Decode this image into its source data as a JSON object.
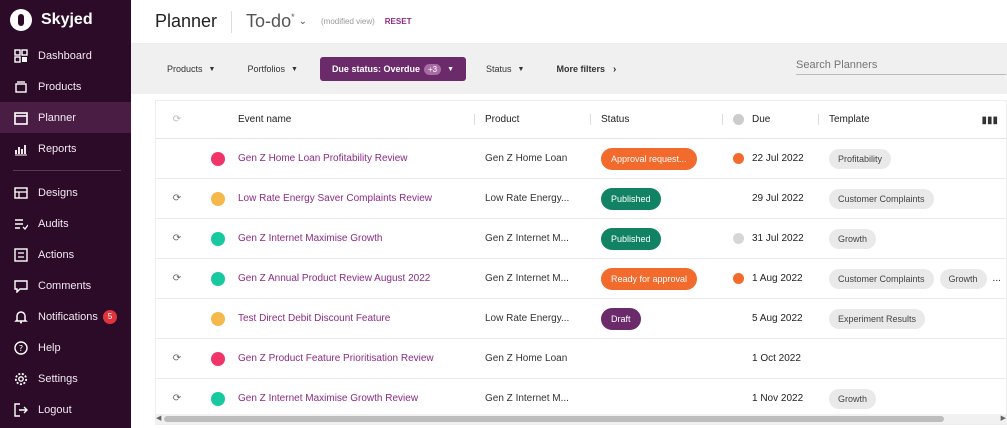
{
  "brand": {
    "name": "Skyjed"
  },
  "sidebar": {
    "items": [
      {
        "label": "Dashboard",
        "icon": "dashboard-icon"
      },
      {
        "label": "Products",
        "icon": "products-icon"
      },
      {
        "label": "Planner",
        "icon": "calendar-icon",
        "active": true
      },
      {
        "label": "Reports",
        "icon": "reports-icon"
      },
      {
        "label": "Designs",
        "icon": "designs-icon"
      },
      {
        "label": "Audits",
        "icon": "audits-icon"
      },
      {
        "label": "Actions",
        "icon": "actions-icon"
      },
      {
        "label": "Comments",
        "icon": "comments-icon"
      },
      {
        "label": "Notifications",
        "icon": "bell-icon",
        "badge": "5"
      },
      {
        "label": "Help",
        "icon": "help-icon"
      },
      {
        "label": "Settings",
        "icon": "settings-icon"
      },
      {
        "label": "Logout",
        "icon": "logout-icon"
      }
    ]
  },
  "header": {
    "title": "Planner",
    "view": "To-do",
    "view_mark": "*",
    "modified": "(modified view)",
    "reset": "RESET"
  },
  "filters": {
    "products": "Products",
    "portfolios": "Portfolios",
    "due_status": "Due status: Overdue",
    "due_count": "+3",
    "status": "Status",
    "more": "More filters",
    "search_placeholder": "Search Planners"
  },
  "table": {
    "headers": {
      "event": "Event name",
      "product": "Product",
      "status": "Status",
      "due": "Due",
      "template": "Template"
    },
    "rows": [
      {
        "sync": false,
        "dot": "#f0356a",
        "event": "Gen Z Home Loan Profitability Review",
        "product": "Gen Z Home Loan",
        "status": "Approval request...",
        "status_color": "#f26a2c",
        "due_icon": "overdue",
        "due": "22 Jul 2022",
        "templates": [
          "Profitability"
        ]
      },
      {
        "sync": true,
        "dot": "#f5b84a",
        "event": "Low Rate Energy Saver Complaints Review",
        "product": "Low Rate Energy...",
        "status": "Published",
        "status_color": "#128264",
        "due_icon": "",
        "due": "29 Jul 2022",
        "templates": [
          "Customer Complaints"
        ]
      },
      {
        "sync": true,
        "dot": "#18c9a0",
        "event": "Gen Z Internet Maximise Growth",
        "product": "Gen Z Internet M...",
        "status": "Published",
        "status_color": "#128264",
        "due_icon": "upcoming",
        "due": "31 Jul 2022",
        "templates": [
          "Growth"
        ]
      },
      {
        "sync": true,
        "dot": "#18c9a0",
        "event": "Gen Z Annual Product Review August 2022",
        "product": "Gen Z Internet M...",
        "status": "Ready for approval",
        "status_color": "#f26a2c",
        "due_icon": "overdue",
        "due": "1 Aug 2022",
        "templates": [
          "Customer Complaints",
          "Growth",
          "..."
        ]
      },
      {
        "sync": false,
        "dot": "#f5b84a",
        "event": "Test Direct Debit Discount Feature",
        "product": "Low Rate Energy...",
        "status": "Draft",
        "status_color": "#6b2a6a",
        "due_icon": "",
        "due": "5 Aug 2022",
        "templates": [
          "Experiment Results"
        ]
      },
      {
        "sync": true,
        "dot": "#f0356a",
        "event": "Gen Z Product Feature Prioritisation Review",
        "product": "Gen Z Home Loan",
        "status": "",
        "status_color": "",
        "due_icon": "",
        "due": "1 Oct 2022",
        "templates": []
      },
      {
        "sync": true,
        "dot": "#18c9a0",
        "event": "Gen Z Internet Maximise Growth Review",
        "product": "Gen Z Internet M...",
        "status": "",
        "status_color": "",
        "due_icon": "",
        "due": "1 Nov 2022",
        "templates": [
          "Growth"
        ]
      }
    ]
  }
}
